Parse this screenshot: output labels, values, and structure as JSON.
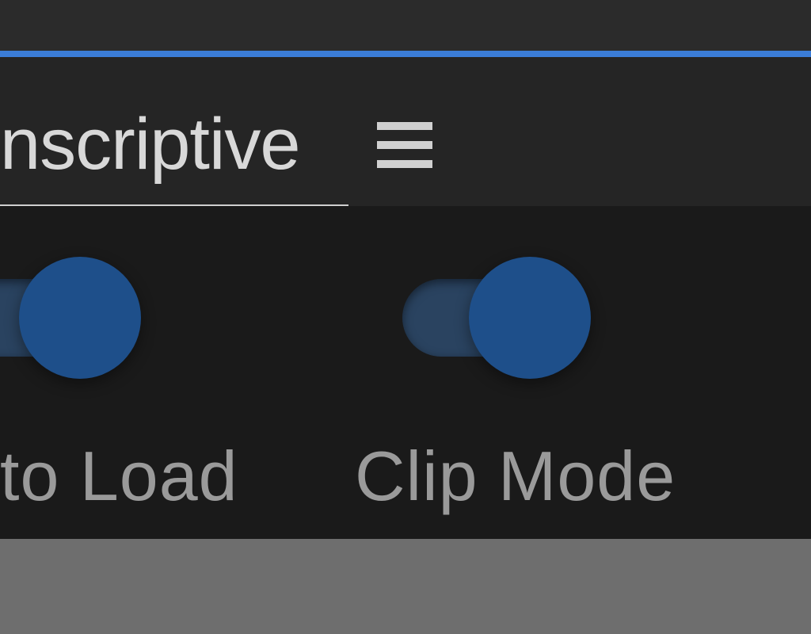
{
  "header": {
    "tab_title": "nscriptive"
  },
  "toggles": {
    "auto_load": {
      "label": "to Load",
      "state": true
    },
    "clip_mode": {
      "label": "Clip Mode",
      "state": true
    }
  },
  "colors": {
    "accent_blue": "#3b7dd8",
    "toggle_track": "#2a4360",
    "toggle_knob": "#1e4f8a"
  }
}
